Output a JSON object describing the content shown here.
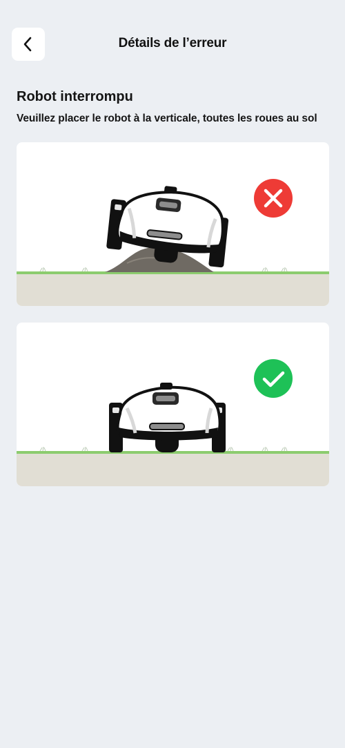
{
  "header": {
    "title": "Détails de l’erreur",
    "back_icon": "chevron-left-icon"
  },
  "error": {
    "heading": "Robot interrompu",
    "description": "Veuillez placer le robot à la verticale, toutes les roues au sol"
  },
  "illustrations": [
    {
      "status": "incorrect",
      "icon": "x-icon",
      "badge_color": "#ee3b36"
    },
    {
      "status": "correct",
      "icon": "check-icon",
      "badge_color": "#1ec157"
    }
  ],
  "colors": {
    "background": "#eceff3",
    "card": "#ffffff",
    "grass": "#8ccc6e",
    "ground": "#e1ded4",
    "mound": "#6f6a63"
  }
}
